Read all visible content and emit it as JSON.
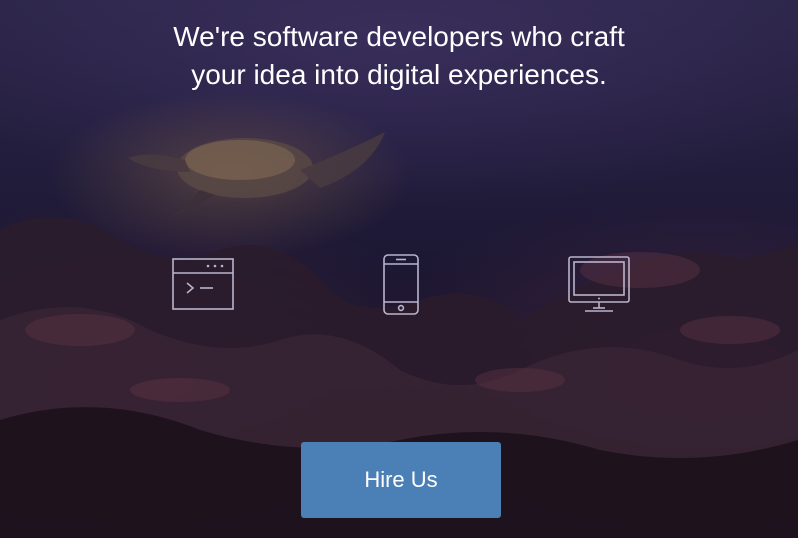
{
  "hero": {
    "headline_line1": "We're software developers who craft",
    "headline_line2": "your idea into digital experiences.",
    "cta_label": "Hire Us"
  },
  "services": [
    {
      "icon": "terminal-window-icon"
    },
    {
      "icon": "smartphone-icon"
    },
    {
      "icon": "desktop-monitor-icon"
    }
  ],
  "colors": {
    "cta_background": "#4a80b5",
    "headline_text": "#ffffff",
    "icon_stroke": "#b9b4cc"
  }
}
